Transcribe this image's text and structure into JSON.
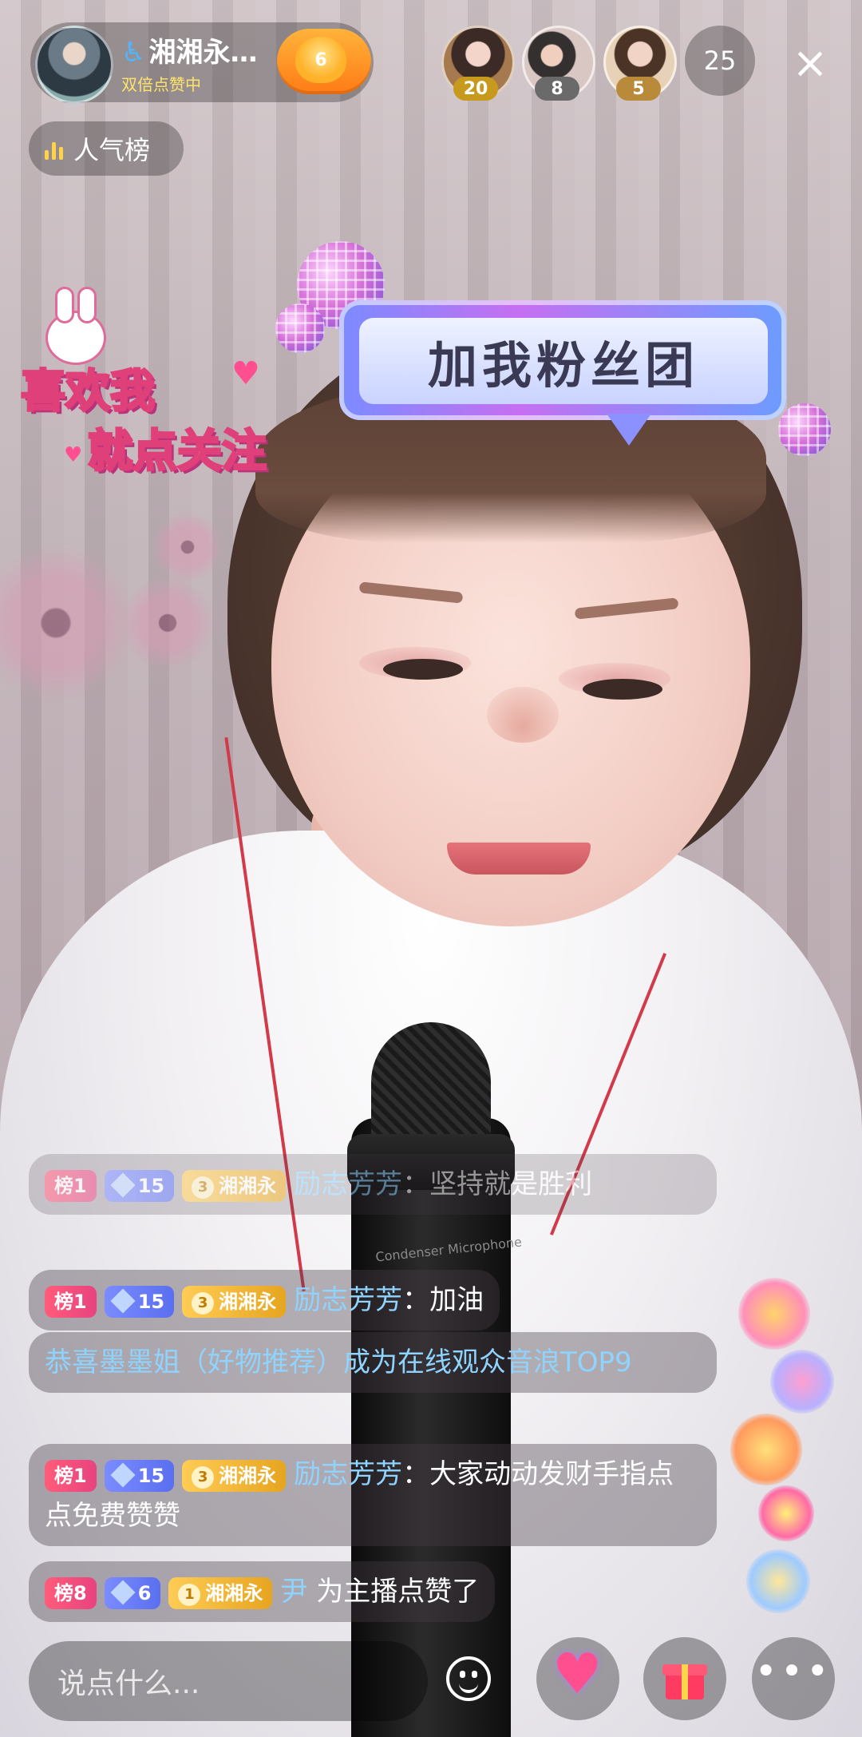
{
  "host": {
    "name": "湘湘永…",
    "accessibility_icon": "♿",
    "status": "双倍点赞中",
    "fan_level": "6"
  },
  "top_viewers": [
    {
      "badge": "20",
      "badge_color": "#c79a1e"
    },
    {
      "badge": "8",
      "badge_color": "#6a6a6a"
    },
    {
      "badge": "5",
      "badge_color": "#b98a3a"
    }
  ],
  "viewer_count": "25",
  "close_icon": "×",
  "rank_button": "人气榜",
  "stickers": {
    "fan_club_sign": "加我粉丝团",
    "follow_line1": "喜欢我",
    "follow_line2_a": "就点",
    "follow_line2_b": "关注"
  },
  "mic_print": "Condenser Microphone",
  "chat": [
    {
      "rank": "榜1",
      "level": "15",
      "fan_level": "3",
      "fan_name": "湘湘永",
      "user": "励志芳芳",
      "text": "：坚持就是胜利"
    },
    {
      "rank": "榜1",
      "level": "15",
      "fan_level": "3",
      "fan_name": "湘湘永",
      "user": "励志芳芳",
      "text": "：加油"
    },
    {
      "system": "恭喜墨墨姐（好物推荐）成为在线观众音浪TOP9"
    },
    {
      "rank": "榜1",
      "level": "15",
      "fan_level": "3",
      "fan_name": "湘湘永",
      "user": "励志芳芳",
      "text": "：大家动动发财手指点点免费赞赞"
    },
    {
      "rank": "榜8",
      "level": "6",
      "fan_level": "1",
      "fan_name": "湘湘永",
      "user": "尹",
      "text": " 为主播点赞了"
    }
  ],
  "bottom_bar": {
    "input_placeholder": "说点什么...",
    "emoji_icon": "emoji-icon",
    "like_icon": "heart-icon",
    "gift_icon": "gift-icon",
    "more_icon": "•••"
  }
}
